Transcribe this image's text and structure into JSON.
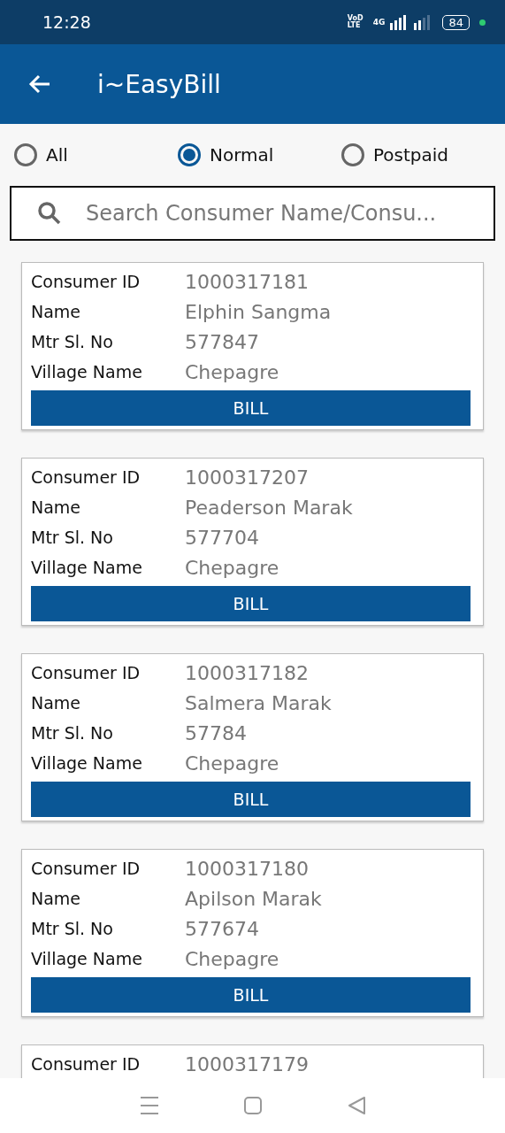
{
  "status_bar": {
    "time": "12:28",
    "network_label": "VoD LTE",
    "network_type": "4G",
    "battery": "84"
  },
  "app_bar": {
    "title": "i~EasyBill"
  },
  "filter": [
    {
      "label": "All",
      "selected": false
    },
    {
      "label": "Normal",
      "selected": true
    },
    {
      "label": "Postpaid",
      "selected": false
    }
  ],
  "search": {
    "placeholder": "Search Consumer Name/Consu..."
  },
  "consumers": [
    {
      "fields": [
        {
          "label": "Consumer ID",
          "value": "1000317181"
        },
        {
          "label": "Name",
          "value": "Elphin Sangma"
        },
        {
          "label": "Mtr Sl. No",
          "value": "577847"
        },
        {
          "label": "Village Name",
          "value": "Chepagre"
        }
      ],
      "button": "BILL"
    },
    {
      "fields": [
        {
          "label": "Consumer ID",
          "value": "1000317207"
        },
        {
          "label": "Name",
          "value": "Peaderson Marak"
        },
        {
          "label": "Mtr Sl. No",
          "value": "577704"
        },
        {
          "label": "Village Name",
          "value": "Chepagre"
        }
      ],
      "button": "BILL"
    },
    {
      "fields": [
        {
          "label": "Consumer ID",
          "value": "1000317182"
        },
        {
          "label": "Name",
          "value": "Salmera Marak"
        },
        {
          "label": "Mtr Sl. No",
          "value": "57784"
        },
        {
          "label": "Village Name",
          "value": "Chepagre"
        }
      ],
      "button": "BILL"
    },
    {
      "fields": [
        {
          "label": "Consumer ID",
          "value": "1000317180"
        },
        {
          "label": "Name",
          "value": "Apilson Marak"
        },
        {
          "label": "Mtr Sl. No",
          "value": "577674"
        },
        {
          "label": "Village Name",
          "value": "Chepagre"
        }
      ],
      "button": "BILL"
    },
    {
      "fields": [
        {
          "label": "Consumer ID",
          "value": "1000317179"
        }
      ]
    }
  ]
}
